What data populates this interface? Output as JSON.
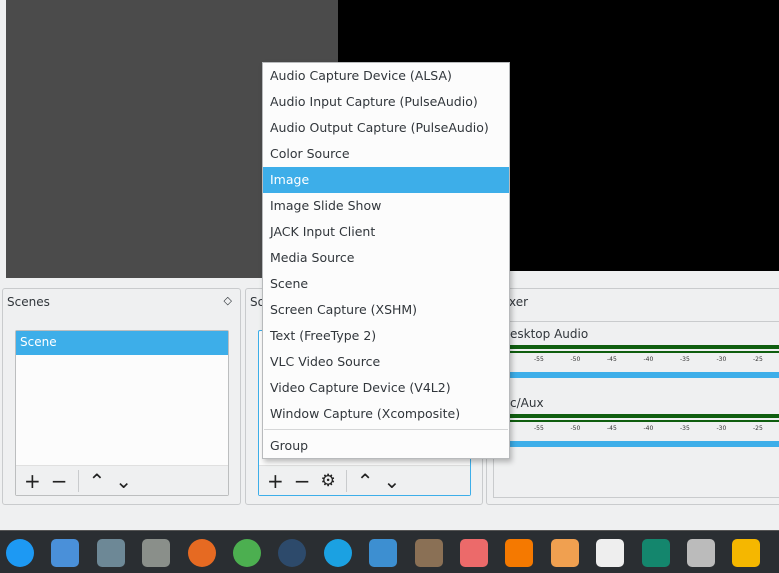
{
  "menu": {
    "items": [
      "Audio Capture Device (ALSA)",
      "Audio Input Capture (PulseAudio)",
      "Audio Output Capture (PulseAudio)",
      "Color Source",
      "Image",
      "Image Slide Show",
      "JACK Input Client",
      "Media Source",
      "Scene",
      "Screen Capture (XSHM)",
      "Text (FreeType 2)",
      "VLC Video Source",
      "Video Capture Device (V4L2)",
      "Window Capture (Xcomposite)"
    ],
    "selected": "Image",
    "group": "Group"
  },
  "scenes": {
    "title": "Scenes",
    "items": [
      "Scene"
    ],
    "toggle_icon": "◇"
  },
  "sources": {
    "title_visible": "So"
  },
  "mixer": {
    "title_visible": "xer",
    "channels": [
      {
        "name_visible": "esktop Audio"
      },
      {
        "name_visible": "c/Aux"
      }
    ],
    "ticks": [
      "-55",
      "-50",
      "-45",
      "-40",
      "-35",
      "-30",
      "-25"
    ]
  },
  "colors": {
    "accent": "#3daee9",
    "meter": "#0f5e0f",
    "taskbar": "#2a2e32"
  },
  "taskbar": {
    "icons": [
      "kde-menu-icon",
      "desktop-icon",
      "screenshot-icon",
      "file-manager-icon",
      "firefox-icon",
      "chrome-icon",
      "steam-icon",
      "skype-icon",
      "shutter-icon",
      "krita-icon",
      "presentation-icon",
      "vlc-icon",
      "feather-icon",
      "document-icon",
      "notes-icon",
      "pdf-editor-icon",
      "audio-recorder-icon"
    ]
  }
}
